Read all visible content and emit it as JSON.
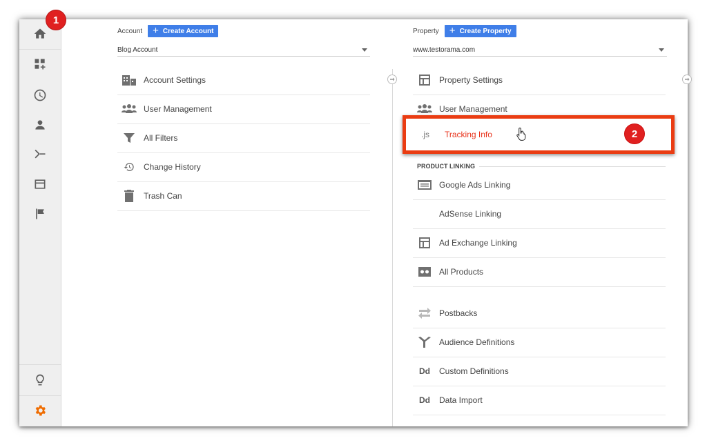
{
  "badges": {
    "step1": "1",
    "step2": "2"
  },
  "rail": {
    "items": [
      "home-icon",
      "dashboard-add-icon",
      "clock-icon",
      "person-icon",
      "flow-icon",
      "display-icon",
      "flag-icon"
    ],
    "bottom": [
      "lightbulb-icon",
      "gear-icon"
    ],
    "accent": "#ef6c00"
  },
  "account": {
    "label": "Account",
    "create_label": "Create Account",
    "selected": "Blog Account",
    "items": [
      {
        "label": "Account Settings",
        "icon": "building-icon"
      },
      {
        "label": "User Management",
        "icon": "people-icon"
      },
      {
        "label": "All Filters",
        "icon": "filter-icon"
      },
      {
        "label": "Change History",
        "icon": "history-icon"
      },
      {
        "label": "Trash Can",
        "icon": "trash-icon"
      }
    ]
  },
  "property": {
    "label": "Property",
    "create_label": "Create Property",
    "selected": "www.testorama.com",
    "items_top": [
      {
        "label": "Property Settings",
        "icon": "window-icon"
      },
      {
        "label": "User Management",
        "icon": "people-icon"
      }
    ],
    "tracking": {
      "label": "Tracking Info",
      "icon_text": ".js",
      "color": "#e8341c"
    },
    "section": "PRODUCT LINKING",
    "linking": [
      {
        "label": "Google Ads Linking",
        "icon": "ads-icon"
      },
      {
        "label": "AdSense Linking",
        "icon": ""
      },
      {
        "label": "Ad Exchange Linking",
        "icon": "window-icon"
      },
      {
        "label": "All Products",
        "icon": "all-products-icon"
      }
    ],
    "more": [
      {
        "label": "Postbacks",
        "icon": "postback-icon"
      },
      {
        "label": "Audience Definitions",
        "icon": "audience-icon"
      },
      {
        "label": "Custom Definitions",
        "icon_text": "Dd"
      },
      {
        "label": "Data Import",
        "icon_text": "Dd"
      }
    ]
  },
  "colors": {
    "button": "#3f7ee8",
    "highlight": "#ea3c12",
    "badge": "#e02020"
  }
}
